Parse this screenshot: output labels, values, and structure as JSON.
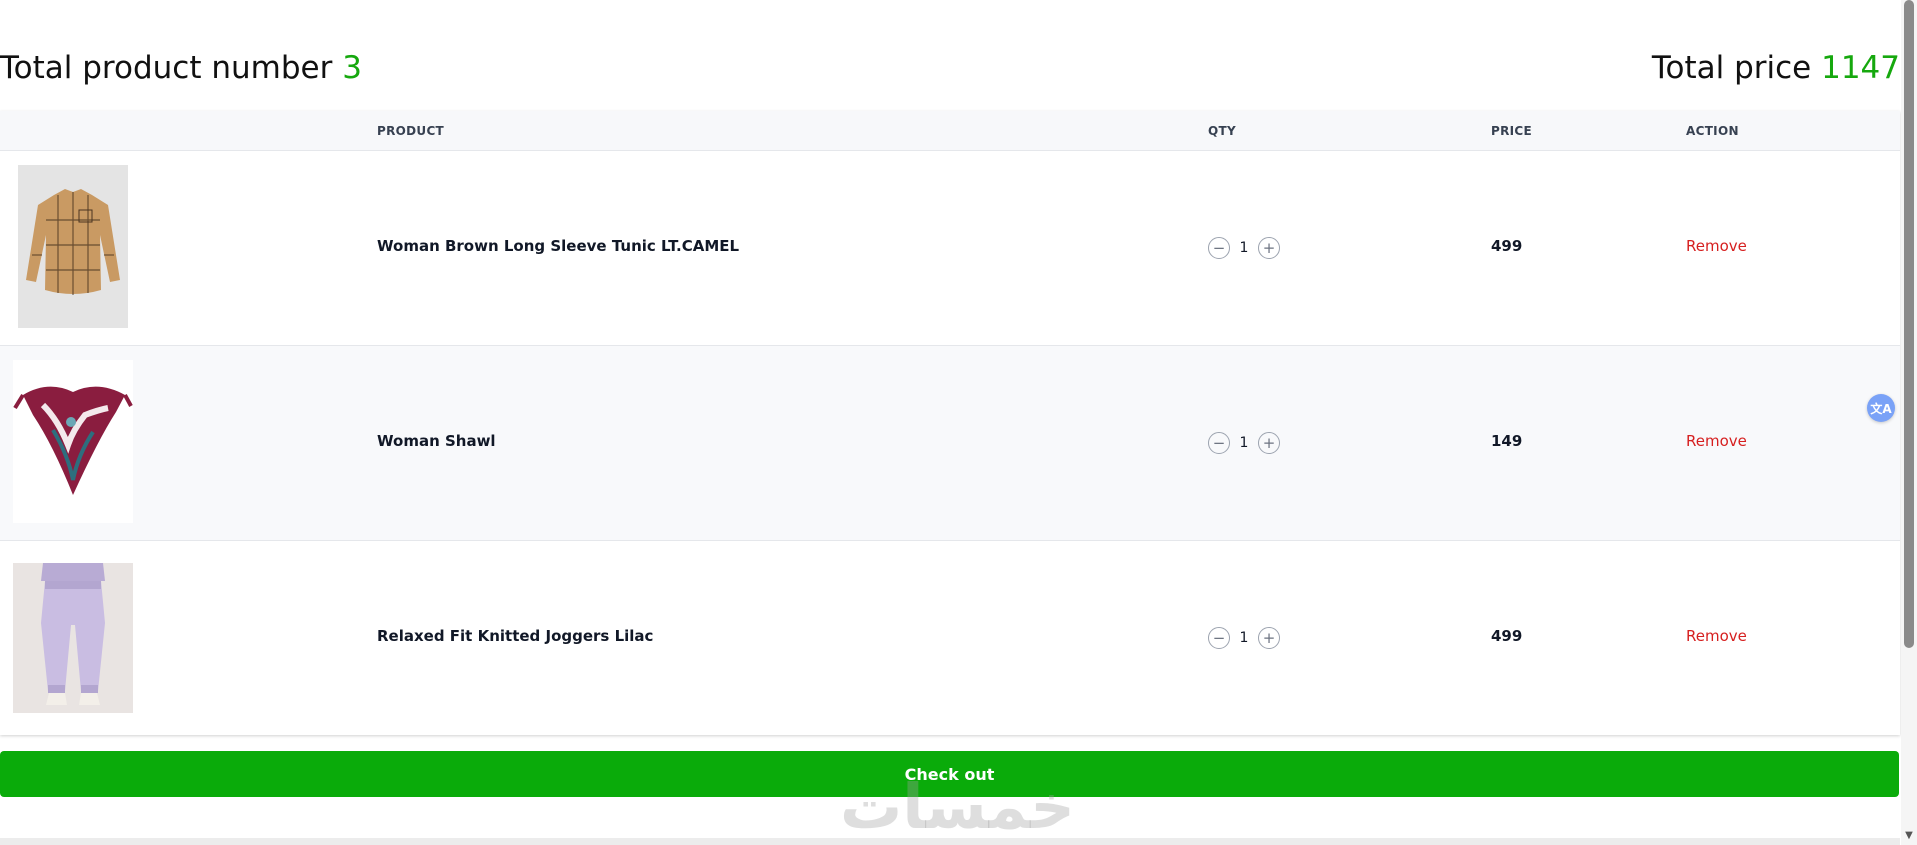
{
  "summary": {
    "total_products_label": "Total product number",
    "total_products_value": "3",
    "total_price_label": "Total price",
    "total_price_value": "1147"
  },
  "table": {
    "headers": {
      "product": "PRODUCT",
      "qty": "QTY",
      "price": "PRICE",
      "action": "ACTION"
    },
    "rows": [
      {
        "name": "Woman Brown Long Sleeve Tunic LT.CAMEL",
        "qty": "1",
        "price": "499",
        "action": "Remove"
      },
      {
        "name": "Woman Shawl",
        "qty": "1",
        "price": "149",
        "action": "Remove"
      },
      {
        "name": "Relaxed Fit Knitted Joggers Lilac",
        "qty": "1",
        "price": "499",
        "action": "Remove"
      }
    ]
  },
  "buttons": {
    "decrement": "−",
    "increment": "+",
    "checkout": "Check out"
  },
  "translate_widget": "文A",
  "watermark": "خمسات",
  "colors": {
    "accent_green": "#0aab0a",
    "remove_red": "#d61f1f",
    "header_bg": "#f7f8fa"
  },
  "icons": [
    "minus-icon",
    "plus-icon",
    "translate-icon"
  ]
}
